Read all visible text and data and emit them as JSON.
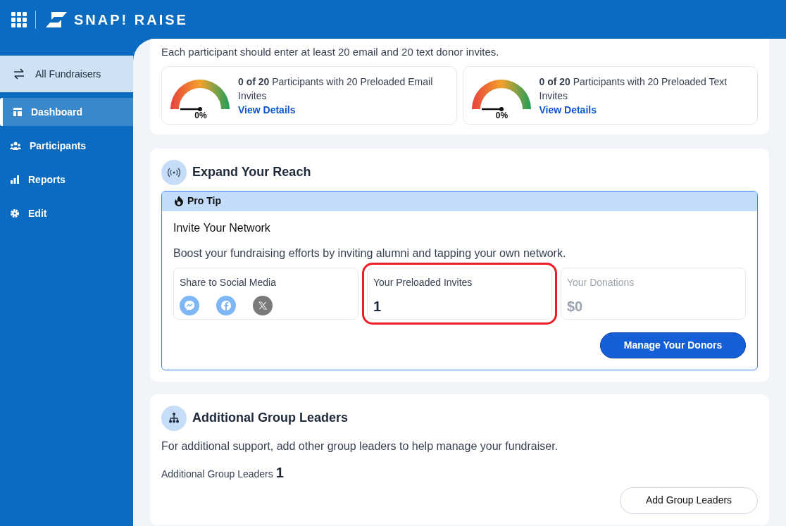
{
  "header": {
    "brand": "SNAP! RAISE"
  },
  "sidebar": {
    "switch_label": "All Fundraisers",
    "items": [
      {
        "label": "Dashboard",
        "selected": true
      },
      {
        "label": "Participants",
        "selected": false
      },
      {
        "label": "Reports",
        "selected": false
      },
      {
        "label": "Edit",
        "selected": false
      }
    ]
  },
  "invites_card": {
    "intro": "Each participant should enter at least 20 email and 20 text donor invites.",
    "gauges": [
      {
        "reading": "0%",
        "text": "**0 of 20** Participants with 20 Preloaded Email Invites",
        "link": "View Details"
      },
      {
        "reading": "0%",
        "text": "**0 of 20** Participants with 20 Preloaded Text Invites",
        "link": "View Details"
      }
    ]
  },
  "reach_card": {
    "title": "Expand Your Reach",
    "tip_label": "Pro Tip",
    "tip_title": "Invite Your Network",
    "tip_text": "Boost your fundraising efforts by inviting alumni and tapping your own network.",
    "panels": [
      {
        "kind": "social",
        "label": "Share to Social Media",
        "disabled": false,
        "highlighted": false
      },
      {
        "kind": "stat",
        "label": "Your Preloaded Invites",
        "value": "1",
        "disabled": false,
        "highlighted": true
      },
      {
        "kind": "stat",
        "label": "Your Donations",
        "value": "$0",
        "disabled": true,
        "highlighted": false
      }
    ],
    "button": "Manage Your Donors"
  },
  "leaders_card": {
    "title": "Additional Group Leaders",
    "text": "For additional support, add other group leaders to help manage your fundraiser.",
    "count_label": "Additional Group Leaders",
    "count": "1",
    "button": "Add Group Leaders"
  }
}
